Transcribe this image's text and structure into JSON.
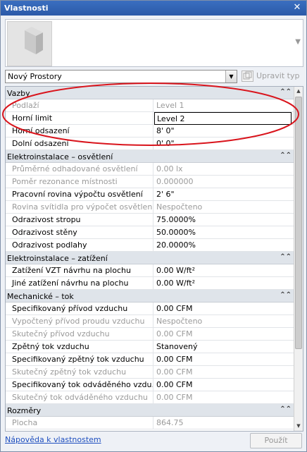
{
  "window": {
    "title": "Vlastnosti",
    "close_glyph": "✕"
  },
  "type_selector": {
    "value": "Nový Prostory",
    "edit_type_label": "Upravit typ"
  },
  "groups": [
    {
      "label": "Vazby",
      "collapse": "⌃⌃",
      "rows": [
        {
          "name": "Podlaží",
          "value": "Level 1",
          "disabled": true
        },
        {
          "name": "Horní limit",
          "value": "Level 2",
          "disabled": false,
          "editing": true
        },
        {
          "name": "Horní odsazení",
          "value": "8'  0\"",
          "disabled": false
        },
        {
          "name": "Dolní odsazení",
          "value": "0'  0\"",
          "disabled": false
        }
      ]
    },
    {
      "label": "Elektroinstalace – osvětlení",
      "collapse": "⌃⌃",
      "rows": [
        {
          "name": "Průměrné odhadované osvětlení",
          "value": "0.00 lx",
          "disabled": true
        },
        {
          "name": "Poměr rezonance místnosti",
          "value": "0.000000",
          "disabled": true
        },
        {
          "name": "Pracovní rovina výpočtu osvětlení",
          "value": "2'  6\"",
          "disabled": false
        },
        {
          "name": "Rovina svítidla pro výpočet osvětlení",
          "value": "Nespočteno",
          "disabled": true
        },
        {
          "name": "Odrazivost stropu",
          "value": "75.0000%",
          "disabled": false
        },
        {
          "name": "Odrazivost stěny",
          "value": "50.0000%",
          "disabled": false
        },
        {
          "name": "Odrazivost podlahy",
          "value": "20.0000%",
          "disabled": false
        }
      ]
    },
    {
      "label": "Elektroinstalace – zatížení",
      "collapse": "⌃⌃",
      "rows": [
        {
          "name": "Zatížení VZT návrhu na plochu",
          "value": "0.00 W/ft²",
          "disabled": false
        },
        {
          "name": "Jiné zatížení návrhu na plochu",
          "value": "0.00 W/ft²",
          "disabled": false
        }
      ]
    },
    {
      "label": "Mechanické – tok",
      "collapse": "⌃⌃",
      "rows": [
        {
          "name": "Specifikovaný přívod vzduchu",
          "value": "0.00 CFM",
          "disabled": false
        },
        {
          "name": "Vypočtený přívod proudu vzduchu",
          "value": "Nespočteno",
          "disabled": true
        },
        {
          "name": "Skutečný přívod vzduchu",
          "value": "0.00 CFM",
          "disabled": true
        },
        {
          "name": "Zpětný tok vzduchu",
          "value": "Stanovený",
          "disabled": false
        },
        {
          "name": "Specifikovaný zpětný tok vzduchu",
          "value": "0.00 CFM",
          "disabled": false
        },
        {
          "name": "Skutečný zpětný tok vzduchu",
          "value": "0.00 CFM",
          "disabled": true
        },
        {
          "name": "Specifikovaný tok odváděného vzdu...",
          "value": "0.00 CFM",
          "disabled": false
        },
        {
          "name": "Skutečný tok odváděného vzduchu",
          "value": "0.00 CFM",
          "disabled": true
        }
      ]
    },
    {
      "label": "Rozměry",
      "collapse": "⌃⌃",
      "rows": [
        {
          "name": "Plocha",
          "value": "864.75",
          "disabled": true
        }
      ]
    }
  ],
  "footer": {
    "help_link": "Nápověda k vlastnostem",
    "apply_label": "Použít"
  },
  "colors": {
    "title_bg": "#2b5aa8",
    "highlight": "#d9141c",
    "link": "#1f4fbf"
  }
}
